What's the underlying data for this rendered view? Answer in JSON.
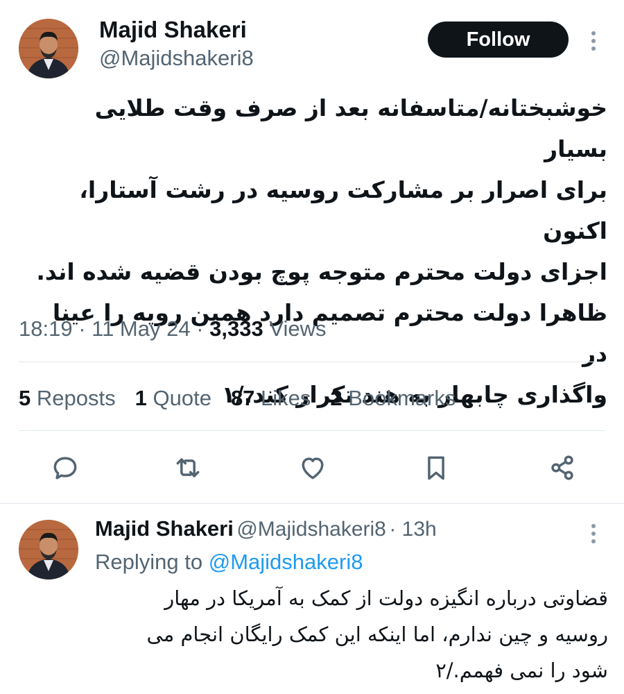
{
  "tweet": {
    "author_name": "Majid Shakeri",
    "author_handle": "@Majidshakeri8",
    "follow_label": "Follow",
    "body_lines": [
      "خوشبختانه/متاسفانه بعد از صرف وقت طلایی بسیار",
      "برای اصرار بر مشارکت روسیه در رشت آستارا، اکنون",
      "اجزای دولت محترم متوجه پوچ بودن قضیه شده اند.",
      "ظاهرا دولت محترم تصمیم دارد همین رویه را عینا در",
      "واگذاری چابهار به هند تکرار کند./۱"
    ],
    "time": "18:19",
    "date": "11 May 24",
    "views_count": "3,333",
    "views_label": "Views",
    "stats": {
      "reposts_count": "5",
      "reposts_label": "Reposts",
      "quote_count": "1",
      "quote_label": "Quote",
      "likes_count": "87",
      "likes_label": "Likes",
      "bookmarks_count": "2",
      "bookmarks_label": "Bookmarks"
    },
    "actions": [
      "reply-icon",
      "repost-icon",
      "like-icon",
      "bookmark-icon",
      "share-icon"
    ]
  },
  "reply": {
    "author_name": "Majid Shakeri",
    "author_handle": "@Majidshakeri8",
    "age": "13h",
    "replying_prefix": "Replying to",
    "replying_handle": "@Majidshakeri8",
    "body_lines": [
      "قضاوتی درباره انگیزه  دولت از کمک به آمریکا در مهار",
      "روسیه و چین ندارم، اما اینکه این کمک رایگان انجام می",
      "شود را نمی فهمم./۲"
    ]
  },
  "colors": {
    "text_primary": "#0f1419",
    "text_secondary": "#536471",
    "link": "#1d9bf0",
    "divider": "#e1e8ed"
  }
}
